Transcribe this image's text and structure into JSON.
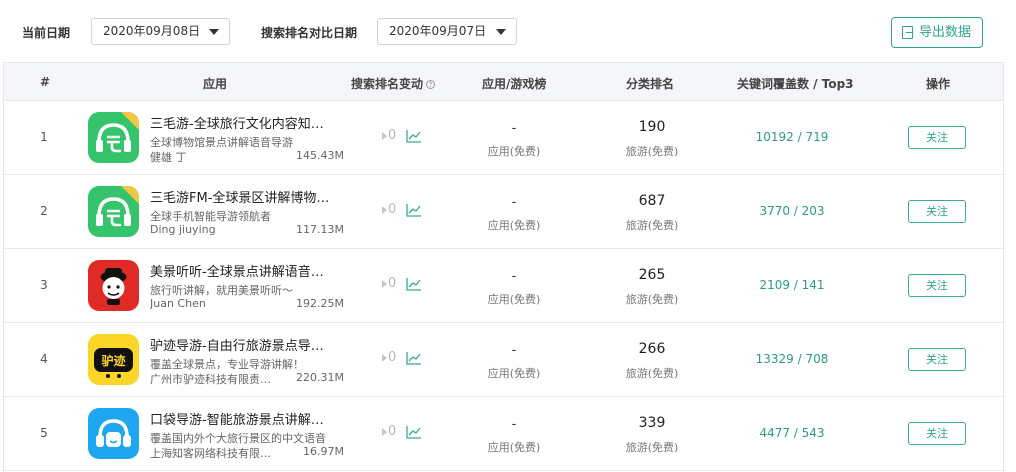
{
  "filters": {
    "current_date_label": "当前日期",
    "current_date_value": "2020年09月08日",
    "compare_date_label": "搜索排名对比日期",
    "compare_date_value": "2020年09月07日",
    "export_label": "导出数据"
  },
  "table": {
    "headers": {
      "num": "#",
      "app": "应用",
      "rank_change": "搜索排名变动",
      "chart": "应用/游戏榜",
      "category": "分类排名",
      "keywords": "关键词覆盖数 / Top3",
      "action": "操作"
    },
    "rows": [
      {
        "num": "1",
        "icon": "sanmao-tour-icon",
        "name": "三毛游-全球旅行文化内容知…",
        "desc": "全球博物馆景点讲解语音导游",
        "developer": "健雄 丁",
        "size": "145.43M",
        "rank_change": "0",
        "chart_rank": "-",
        "chart_type": "应用(免费)",
        "category_rank": "190",
        "category_type": "旅游(免费)",
        "keywords": "10192 / 719",
        "action": "关注"
      },
      {
        "num": "2",
        "icon": "sanmao-fm-icon",
        "name": "三毛游FM-全球景区讲解博物…",
        "desc": "全球手机智能导游领航者",
        "developer": "Ding jiuying",
        "size": "117.13M",
        "rank_change": "0",
        "chart_rank": "-",
        "chart_type": "应用(免费)",
        "category_rank": "687",
        "category_type": "旅游(免费)",
        "keywords": "3770 / 203",
        "action": "关注"
      },
      {
        "num": "3",
        "icon": "meijing-tingting-icon",
        "name": "美景听听-全球景点讲解语音…",
        "desc": "旅行听讲解，就用美景听听～",
        "developer": "Juan Chen",
        "size": "192.25M",
        "rank_change": "0",
        "chart_rank": "-",
        "chart_type": "应用(免费)",
        "category_rank": "265",
        "category_type": "旅游(免费)",
        "keywords": "2109 / 141",
        "action": "关注"
      },
      {
        "num": "4",
        "icon": "lvji-guide-icon",
        "name": "驴迹导游-自由行旅游景点导…",
        "desc": "覆盖全球景点，专业导游讲解！",
        "developer": "广州市驴迹科技有限责…",
        "size": "220.31M",
        "rank_change": "0",
        "chart_rank": "-",
        "chart_type": "应用(免费)",
        "category_rank": "266",
        "category_type": "旅游(免费)",
        "keywords": "13329 / 708",
        "action": "关注"
      },
      {
        "num": "5",
        "icon": "koudai-guide-icon",
        "name": "口袋导游-智能旅游景点讲解…",
        "desc": "覆盖国内外个大旅行景区的中文语音",
        "developer": "上海知客网络科技有限…",
        "size": "16.97M",
        "rank_change": "0",
        "chart_rank": "-",
        "chart_type": "应用(免费)",
        "category_rank": "339",
        "category_type": "旅游(免费)",
        "keywords": "4477 / 543",
        "action": "关注"
      }
    ]
  },
  "colors": {
    "accent": "#2fa58b",
    "header_bg": "#f4f6f9"
  },
  "icon_badge": "免费"
}
